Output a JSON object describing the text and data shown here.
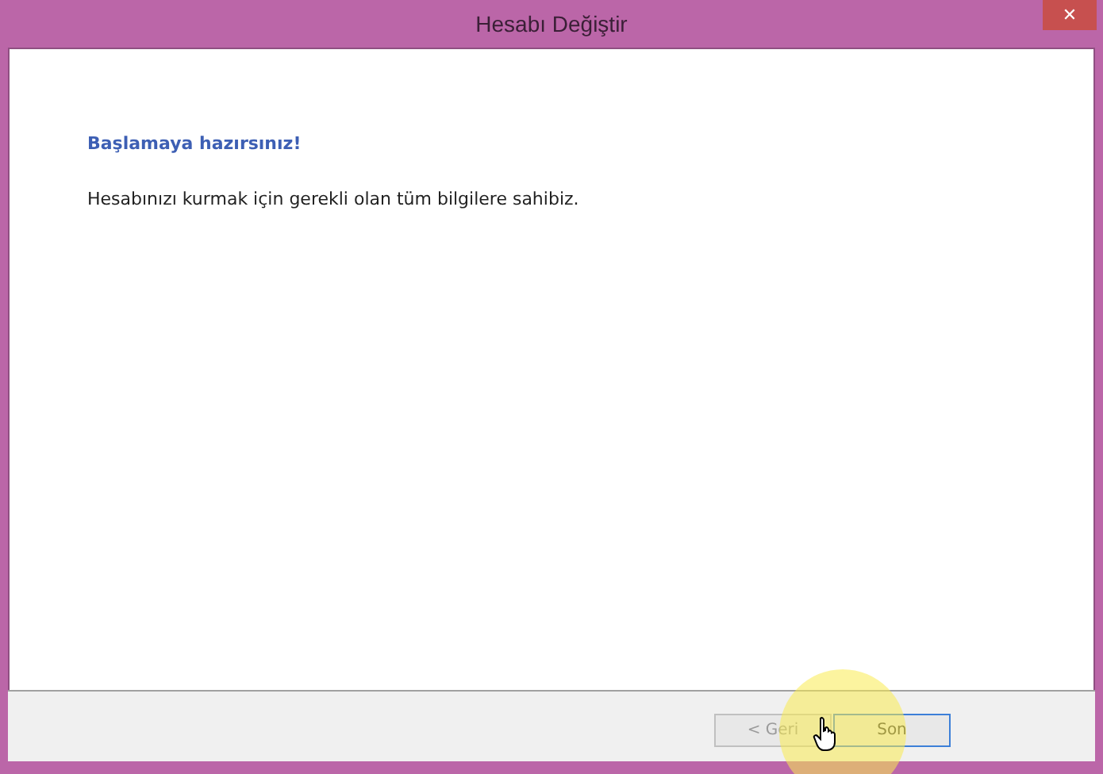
{
  "window": {
    "title": "Hesabı Değiştir",
    "close": "✕"
  },
  "content": {
    "heading": "Başlamaya hazırsınız!",
    "message": "Hesabınızı kurmak için gerekli olan tüm bilgilere sahibiz."
  },
  "buttons": [
    {
      "label": "< Geri",
      "disabled": true,
      "default": false
    },
    {
      "label": "Son",
      "disabled": false,
      "default": true
    }
  ]
}
